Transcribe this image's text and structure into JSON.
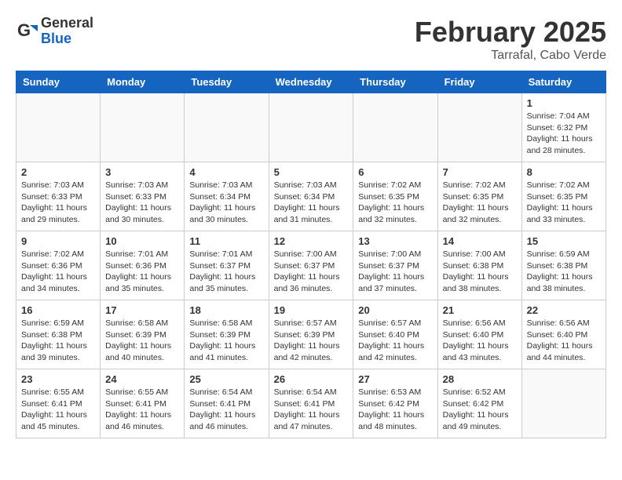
{
  "logo": {
    "general": "General",
    "blue": "Blue"
  },
  "title": "February 2025",
  "location": "Tarrafal, Cabo Verde",
  "days_of_week": [
    "Sunday",
    "Monday",
    "Tuesday",
    "Wednesday",
    "Thursday",
    "Friday",
    "Saturday"
  ],
  "weeks": [
    [
      {
        "day": "",
        "info": ""
      },
      {
        "day": "",
        "info": ""
      },
      {
        "day": "",
        "info": ""
      },
      {
        "day": "",
        "info": ""
      },
      {
        "day": "",
        "info": ""
      },
      {
        "day": "",
        "info": ""
      },
      {
        "day": "1",
        "info": "Sunrise: 7:04 AM\nSunset: 6:32 PM\nDaylight: 11 hours\nand 28 minutes."
      }
    ],
    [
      {
        "day": "2",
        "info": "Sunrise: 7:03 AM\nSunset: 6:33 PM\nDaylight: 11 hours\nand 29 minutes."
      },
      {
        "day": "3",
        "info": "Sunrise: 7:03 AM\nSunset: 6:33 PM\nDaylight: 11 hours\nand 30 minutes."
      },
      {
        "day": "4",
        "info": "Sunrise: 7:03 AM\nSunset: 6:34 PM\nDaylight: 11 hours\nand 30 minutes."
      },
      {
        "day": "5",
        "info": "Sunrise: 7:03 AM\nSunset: 6:34 PM\nDaylight: 11 hours\nand 31 minutes."
      },
      {
        "day": "6",
        "info": "Sunrise: 7:02 AM\nSunset: 6:35 PM\nDaylight: 11 hours\nand 32 minutes."
      },
      {
        "day": "7",
        "info": "Sunrise: 7:02 AM\nSunset: 6:35 PM\nDaylight: 11 hours\nand 32 minutes."
      },
      {
        "day": "8",
        "info": "Sunrise: 7:02 AM\nSunset: 6:35 PM\nDaylight: 11 hours\nand 33 minutes."
      }
    ],
    [
      {
        "day": "9",
        "info": "Sunrise: 7:02 AM\nSunset: 6:36 PM\nDaylight: 11 hours\nand 34 minutes."
      },
      {
        "day": "10",
        "info": "Sunrise: 7:01 AM\nSunset: 6:36 PM\nDaylight: 11 hours\nand 35 minutes."
      },
      {
        "day": "11",
        "info": "Sunrise: 7:01 AM\nSunset: 6:37 PM\nDaylight: 11 hours\nand 35 minutes."
      },
      {
        "day": "12",
        "info": "Sunrise: 7:00 AM\nSunset: 6:37 PM\nDaylight: 11 hours\nand 36 minutes."
      },
      {
        "day": "13",
        "info": "Sunrise: 7:00 AM\nSunset: 6:37 PM\nDaylight: 11 hours\nand 37 minutes."
      },
      {
        "day": "14",
        "info": "Sunrise: 7:00 AM\nSunset: 6:38 PM\nDaylight: 11 hours\nand 38 minutes."
      },
      {
        "day": "15",
        "info": "Sunrise: 6:59 AM\nSunset: 6:38 PM\nDaylight: 11 hours\nand 38 minutes."
      }
    ],
    [
      {
        "day": "16",
        "info": "Sunrise: 6:59 AM\nSunset: 6:38 PM\nDaylight: 11 hours\nand 39 minutes."
      },
      {
        "day": "17",
        "info": "Sunrise: 6:58 AM\nSunset: 6:39 PM\nDaylight: 11 hours\nand 40 minutes."
      },
      {
        "day": "18",
        "info": "Sunrise: 6:58 AM\nSunset: 6:39 PM\nDaylight: 11 hours\nand 41 minutes."
      },
      {
        "day": "19",
        "info": "Sunrise: 6:57 AM\nSunset: 6:39 PM\nDaylight: 11 hours\nand 42 minutes."
      },
      {
        "day": "20",
        "info": "Sunrise: 6:57 AM\nSunset: 6:40 PM\nDaylight: 11 hours\nand 42 minutes."
      },
      {
        "day": "21",
        "info": "Sunrise: 6:56 AM\nSunset: 6:40 PM\nDaylight: 11 hours\nand 43 minutes."
      },
      {
        "day": "22",
        "info": "Sunrise: 6:56 AM\nSunset: 6:40 PM\nDaylight: 11 hours\nand 44 minutes."
      }
    ],
    [
      {
        "day": "23",
        "info": "Sunrise: 6:55 AM\nSunset: 6:41 PM\nDaylight: 11 hours\nand 45 minutes."
      },
      {
        "day": "24",
        "info": "Sunrise: 6:55 AM\nSunset: 6:41 PM\nDaylight: 11 hours\nand 46 minutes."
      },
      {
        "day": "25",
        "info": "Sunrise: 6:54 AM\nSunset: 6:41 PM\nDaylight: 11 hours\nand 46 minutes."
      },
      {
        "day": "26",
        "info": "Sunrise: 6:54 AM\nSunset: 6:41 PM\nDaylight: 11 hours\nand 47 minutes."
      },
      {
        "day": "27",
        "info": "Sunrise: 6:53 AM\nSunset: 6:42 PM\nDaylight: 11 hours\nand 48 minutes."
      },
      {
        "day": "28",
        "info": "Sunrise: 6:52 AM\nSunset: 6:42 PM\nDaylight: 11 hours\nand 49 minutes."
      },
      {
        "day": "",
        "info": ""
      }
    ]
  ]
}
